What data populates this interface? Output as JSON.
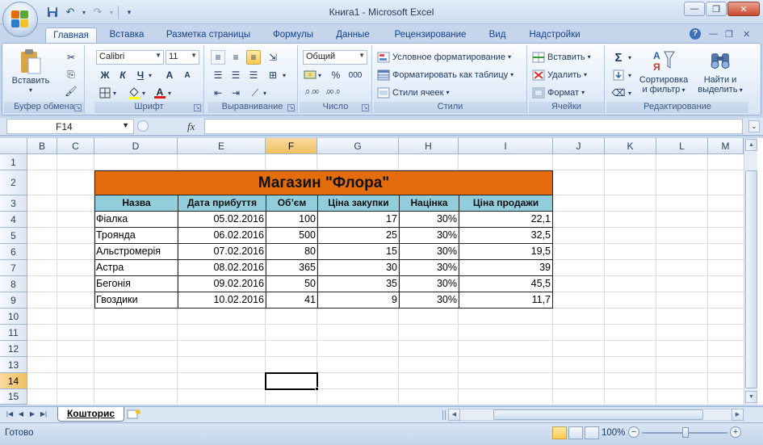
{
  "window": {
    "title": "Книга1 - Microsoft Excel"
  },
  "ribbon_tabs": [
    "Главная",
    "Вставка",
    "Разметка страницы",
    "Формулы",
    "Данные",
    "Рецензирование",
    "Вид",
    "Надстройки"
  ],
  "ribbon": {
    "clipboard": {
      "paste_label": "Вставить",
      "group_label": "Буфер обмена"
    },
    "font": {
      "font_name": "Calibri",
      "font_size": "11",
      "bold": "Ж",
      "italic": "К",
      "underline": "Ч",
      "grow": "A",
      "shrink": "A",
      "font_color_letter": "A",
      "group_label": "Шрифт"
    },
    "alignment": {
      "group_label": "Выравнивание"
    },
    "number": {
      "format": "Общий",
      "percent": "%",
      "thousands": "000",
      "inc_dec": ",0 ,00",
      "dec_dec": ",00 ,0",
      "group_label": "Число"
    },
    "styles": {
      "conditional": "Условное форматирование",
      "as_table": "Форматировать как таблицу",
      "cell_styles": "Стили ячеек",
      "group_label": "Стили"
    },
    "cells": {
      "insert": "Вставить",
      "delete": "Удалить",
      "format": "Формат",
      "group_label": "Ячейки"
    },
    "editing": {
      "sort_line1": "Сортировка",
      "sort_line2": "и фильтр",
      "find_line1": "Найти и",
      "find_line2": "выделить",
      "group_label": "Редактирование"
    }
  },
  "formula_bar": {
    "name_box": "F14",
    "fx": "fx",
    "formula": ""
  },
  "sheet": {
    "columns": [
      "B",
      "C",
      "D",
      "E",
      "F",
      "G",
      "H",
      "I",
      "J",
      "K",
      "L",
      "M"
    ],
    "rows": [
      "1",
      "2",
      "3",
      "4",
      "5",
      "6",
      "7",
      "8",
      "9",
      "10",
      "11",
      "12",
      "13",
      "14",
      "15"
    ],
    "active_column": "F",
    "active_row": "14",
    "table_title": "Магазин \"Флора\"",
    "headers": [
      "Назва",
      "Дата прибуття",
      "Об’єм",
      "Ціна закупки",
      "Націнка",
      "Ціна продажи"
    ],
    "data": [
      [
        "Фіалка",
        "05.02.2016",
        "100",
        "17",
        "30%",
        "22,1"
      ],
      [
        "Троянда",
        "06.02.2016",
        "500",
        "25",
        "30%",
        "32,5"
      ],
      [
        "Альстромерія",
        "07.02.2016",
        "80",
        "15",
        "30%",
        "19,5"
      ],
      [
        "Астра",
        "08.02.2016",
        "365",
        "30",
        "30%",
        "39"
      ],
      [
        "Бегонія",
        "09.02.2016",
        "50",
        "35",
        "30%",
        "45,5"
      ],
      [
        "Гвоздики",
        "10.02.2016",
        "41",
        "9",
        "30%",
        "11,7"
      ]
    ]
  },
  "sheet_tabs": {
    "active": "Кошторис"
  },
  "status": {
    "ready": "Готово",
    "zoom": "100%"
  },
  "colors": {
    "title_fill": "#e46c0a",
    "header_fill": "#92cddc",
    "ribbon_blue": "#c5d6ec"
  }
}
